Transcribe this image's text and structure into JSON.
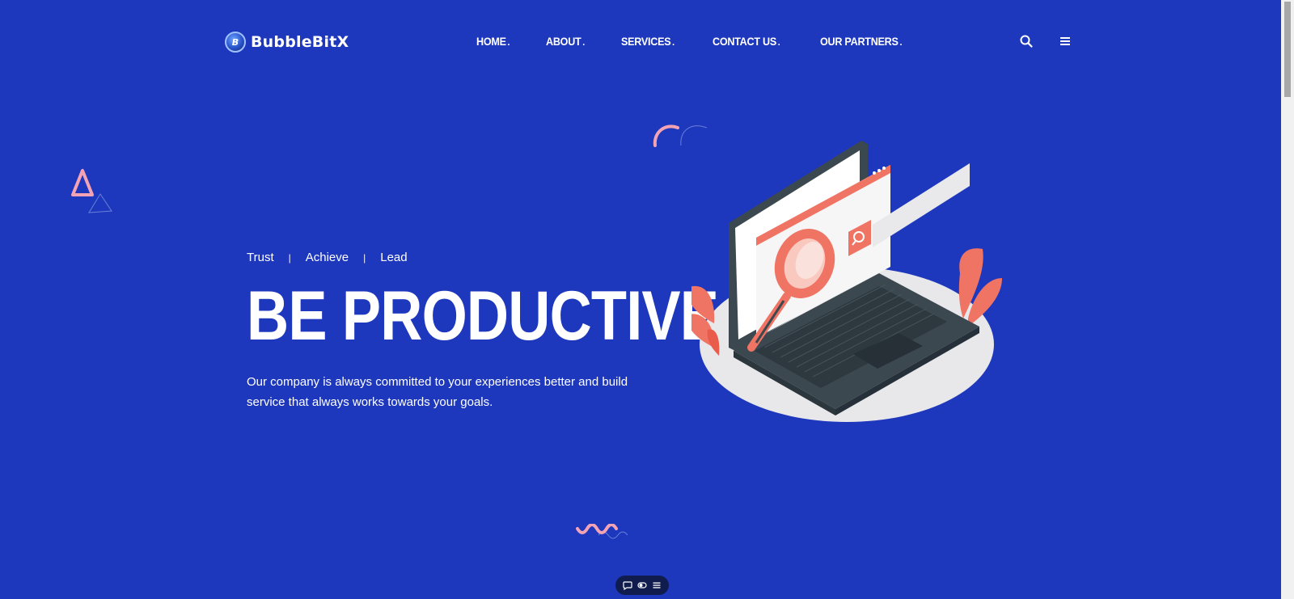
{
  "brand": {
    "name": "BubbleBitX",
    "mark": "B"
  },
  "nav": {
    "items": [
      {
        "label": "HOME",
        "suffix": "."
      },
      {
        "label": "ABOUT",
        "suffix": "."
      },
      {
        "label": "SERVICES",
        "suffix": "."
      },
      {
        "label": "CONTACT US",
        "suffix": "."
      },
      {
        "label": "OUR PARTNERS",
        "suffix": "."
      }
    ]
  },
  "header_icons": [
    "search-icon",
    "menu-icon"
  ],
  "hero": {
    "taglines": [
      "Trust",
      "Achieve",
      "Lead"
    ],
    "separator": "|",
    "title": "BE PRODUCTIVE",
    "description": "Our company is always committed to your experiences better and build service that always works towards your goals."
  },
  "toolbar": {
    "icons": [
      "chat-icon",
      "toggle-icon",
      "list-icon"
    ]
  },
  "colors": {
    "background": "#1e38bd",
    "accent": "#f07464",
    "accent_pink": "#f4a3b4",
    "laptop_dark": "#3b4850",
    "text": "#ffffff"
  }
}
